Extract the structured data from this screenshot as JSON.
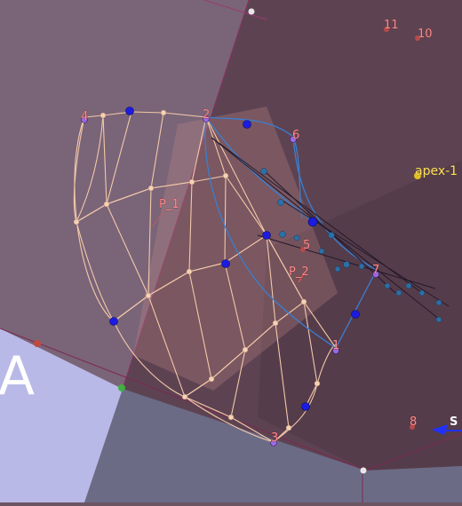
{
  "scene": {
    "point_labels": {
      "p1": "1",
      "p2": "2",
      "p3": "3",
      "p4": "4",
      "p5": "5",
      "p6": "6",
      "p7": "7",
      "p8": "8",
      "p10": "10",
      "p11": "11"
    },
    "region_label": "A",
    "apex_label": "apex-1",
    "param_labels": {
      "P_1": "P_1",
      "P_2": "P_2"
    },
    "axis_label": "S"
  },
  "colors": {
    "background": "#6b5563",
    "left_plane": "#7a6478",
    "right_plane": "#5e4352",
    "blue_region": "#b8b8e6",
    "wireframe": "#f3c9a8",
    "blue_curve": "#3a7fd0",
    "blue_control": "#1c1ce0",
    "label_red": "#ff8b8b",
    "apex_yellow": "#ffe060"
  }
}
